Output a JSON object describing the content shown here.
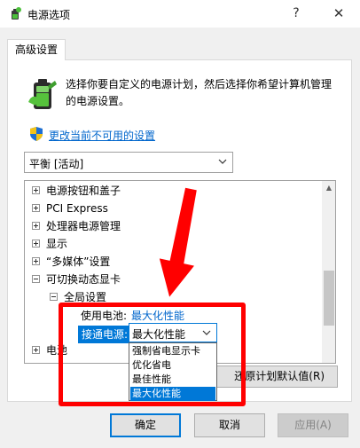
{
  "window": {
    "title": "电源选项",
    "help_glyph": "?",
    "close_glyph": "✕"
  },
  "tab": {
    "label": "高级设置"
  },
  "description": "选择你要自定义的电源计划，然后选择你希望计算机管理的电源设置。",
  "change_link": "更改当前不可用的设置",
  "plan_select": {
    "value": "平衡 [活动]"
  },
  "tree": {
    "items": [
      {
        "label": "电源按钮和盖子",
        "state": "collapsed"
      },
      {
        "label": "PCI Express",
        "state": "collapsed"
      },
      {
        "label": "处理器电源管理",
        "state": "collapsed"
      },
      {
        "label": "显示",
        "state": "collapsed"
      },
      {
        "label": "“多媒体”设置",
        "state": "collapsed"
      },
      {
        "label": "可切换动态显卡",
        "state": "expanded"
      },
      {
        "label": "全局设置",
        "state": "expanded"
      },
      {
        "label": "电池",
        "state": "collapsed"
      }
    ],
    "on_battery": {
      "label": "使用电池:",
      "value": "最大化性能"
    },
    "plugged_in": {
      "label": "接通电源:",
      "value": "最大化性能",
      "options": [
        "强制省电显示卡",
        "优化省电",
        "最佳性能",
        "最大化性能"
      ],
      "selected_index": 3
    }
  },
  "restore_button": "还原计划默认值(R)",
  "buttons": {
    "ok": "确定",
    "cancel": "取消",
    "apply": "应用(A)"
  },
  "colors": {
    "accent": "#0078d7",
    "link": "#0066cc",
    "annotation": "#ff0000"
  }
}
